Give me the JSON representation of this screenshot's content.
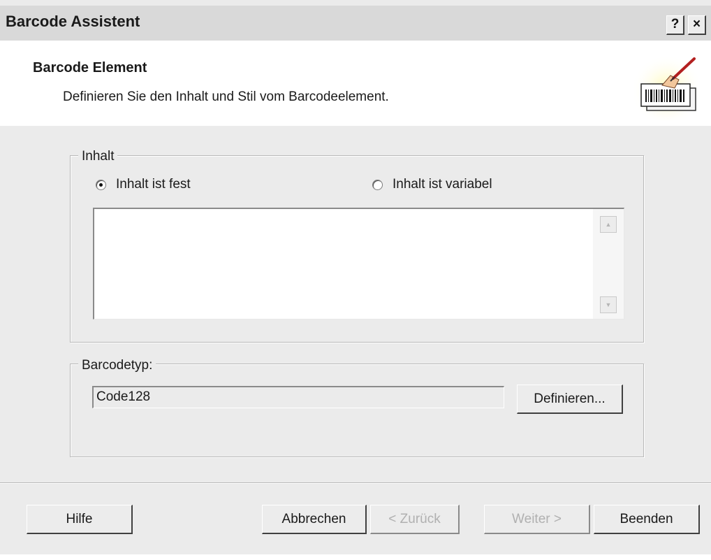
{
  "window": {
    "title": "Barcode Assistent",
    "help_button": "?",
    "close_button": "×"
  },
  "header": {
    "title": "Barcode Element",
    "subtitle": "Definieren Sie den Inhalt und Stil vom Barcodeelement.",
    "icon": "barcode-wizard-icon"
  },
  "content_group": {
    "label": "Inhalt",
    "radio_fixed": {
      "label": "Inhalt ist fest",
      "checked": true
    },
    "radio_variable": {
      "label": "Inhalt ist variabel",
      "checked": false
    },
    "text_value": ""
  },
  "barcode_group": {
    "label": "Barcodetyp:",
    "type_value": "Code128",
    "define_button": "Definieren..."
  },
  "footer": {
    "help": "Hilfe",
    "cancel": "Abbrechen",
    "back": "< Zurück",
    "next": "Weiter >",
    "finish": "Beenden",
    "back_enabled": false,
    "next_enabled": false
  }
}
